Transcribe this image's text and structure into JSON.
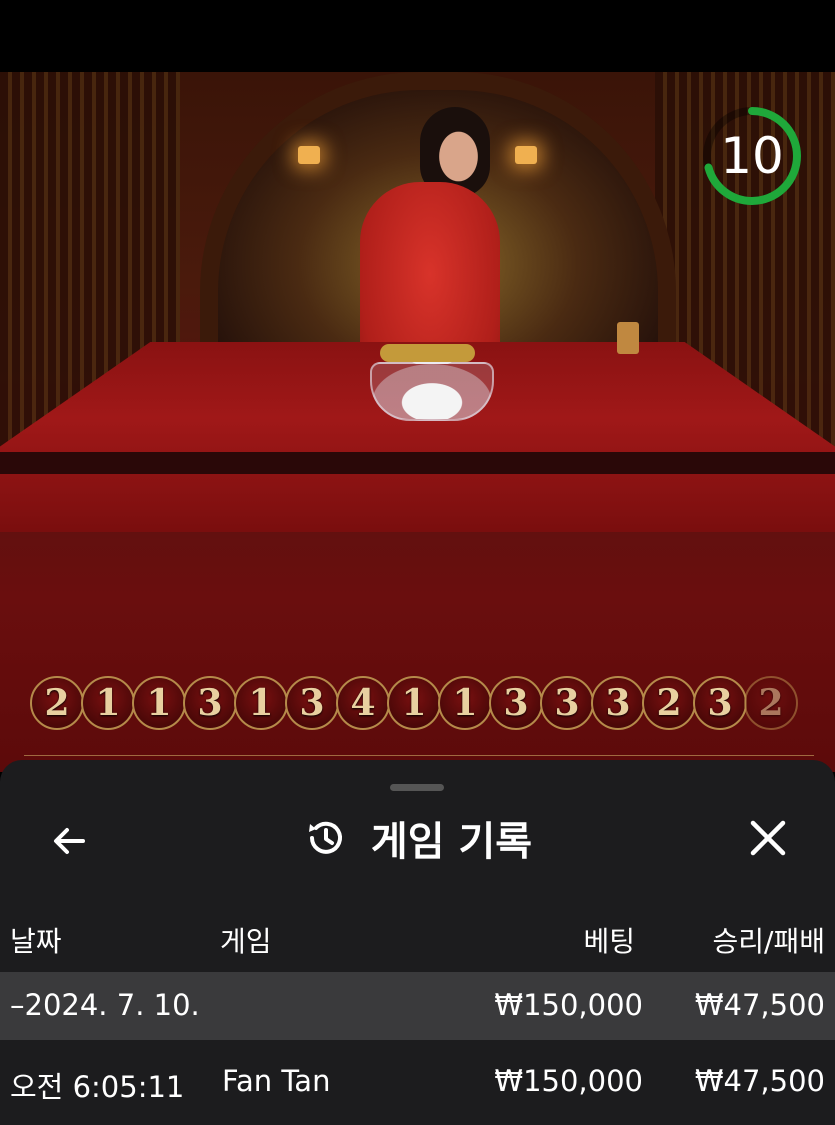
{
  "timer": {
    "value": "10"
  },
  "bead_history": [
    "2",
    "1",
    "1",
    "3",
    "1",
    "3",
    "4",
    "1",
    "1",
    "3",
    "3",
    "3",
    "2",
    "3",
    "2"
  ],
  "panel": {
    "title": "게임 기록",
    "columns": {
      "date": "날짜",
      "game": "게임",
      "bet": "베팅",
      "winloss": "승리/패배"
    },
    "date_row": {
      "date": "–2024. 7. 10.",
      "bet": "₩150,000",
      "winloss": "₩47,500"
    },
    "rows": [
      {
        "time": "오전 6:05:11",
        "game": "Fan Tan",
        "bet": "₩150,000",
        "winloss": "₩47,500"
      }
    ]
  },
  "colors": {
    "panel_bg": "#1c1c1e",
    "date_row_bg": "#3a3a3c",
    "timer_ring": "#1fa83a"
  }
}
